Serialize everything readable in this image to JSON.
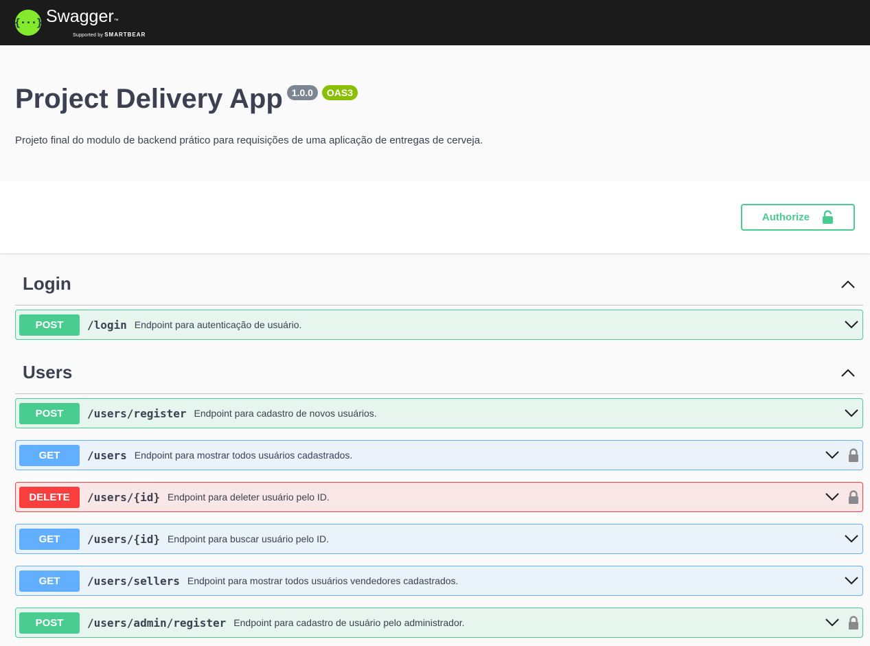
{
  "topbar": {
    "logo_mark": "{···}",
    "brand": "Swagger",
    "tm": "™",
    "supported_by": "Supported by",
    "smartbear": "SMARTBEAR"
  },
  "info": {
    "title": "Project Delivery App",
    "version": "1.0.0",
    "oas": "OAS3",
    "description": "Projeto final do modulo de backend prático para requisições de uma aplicação de entregas de cerveja."
  },
  "scheme": {
    "authorize_label": "Authorize"
  },
  "tags": [
    {
      "name": "Login",
      "operations": [
        {
          "method": "POST",
          "path": "/login",
          "summary": "Endpoint para autenticação de usuário.",
          "locked": false
        }
      ]
    },
    {
      "name": "Users",
      "operations": [
        {
          "method": "POST",
          "path": "/users/register",
          "summary": "Endpoint para cadastro de novos usuários.",
          "locked": false
        },
        {
          "method": "GET",
          "path": "/users",
          "summary": "Endpoint para mostrar todos usuários cadastrados.",
          "locked": true
        },
        {
          "method": "DELETE",
          "path": "/users/{id}",
          "summary": "Endpoint para deleter usuário pelo ID.",
          "locked": true
        },
        {
          "method": "GET",
          "path": "/users/{id}",
          "summary": "Endpoint para buscar usuário pelo ID.",
          "locked": false
        },
        {
          "method": "GET",
          "path": "/users/sellers",
          "summary": "Endpoint para mostrar todos usuários vendedores cadastrados.",
          "locked": false
        },
        {
          "method": "POST",
          "path": "/users/admin/register",
          "summary": "Endpoint para cadastro de usuário pelo administrador.",
          "locked": true
        }
      ]
    }
  ],
  "colors": {
    "post": "#49cc90",
    "get": "#61affe",
    "delete": "#f93e3e",
    "topbar": "#1b1b1b",
    "logo": "#85ea2d"
  },
  "icons": {
    "expand": "chevron-down-icon",
    "collapse": "chevron-up-icon",
    "lock": "lock-icon",
    "unlock": "unlock-icon"
  }
}
